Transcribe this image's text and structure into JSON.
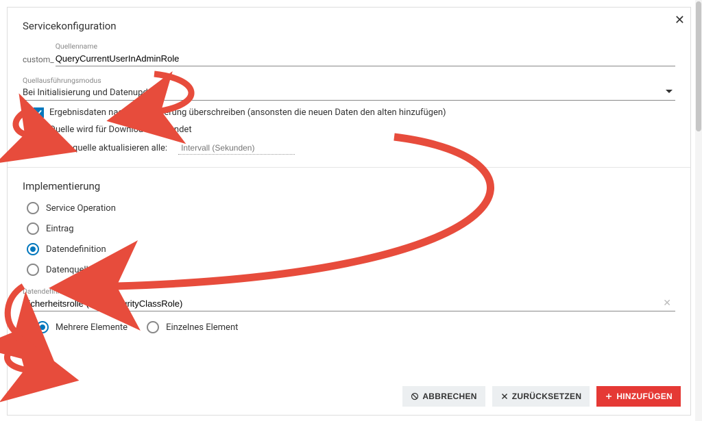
{
  "serviceConfig": {
    "title": "Servicekonfiguration",
    "sourceName": {
      "label": "Quellenname",
      "prefix": "custom_",
      "value": "QueryCurrentUserInAdminRole"
    },
    "execMode": {
      "label": "Quellausführungsmodus",
      "value": "Bei Initialisierung und Datenupdate"
    },
    "overwrite": {
      "checked": true,
      "label": "Ergebnisdaten nach Aktualisierung überschreiben (ansonsten die neuen Daten den alten hinzufügen)"
    },
    "download": {
      "checked": false,
      "label": "Quelle wird für Download verwendet"
    },
    "refresh": {
      "checked": false,
      "label": "Datenquelle aktualisieren alle:",
      "intervalPlaceholder": "Intervall (Sekunden)"
    }
  },
  "implementation": {
    "title": "Implementierung",
    "options": [
      {
        "label": "Service Operation",
        "selected": false
      },
      {
        "label": "Eintrag",
        "selected": false
      },
      {
        "label": "Datendefinition",
        "selected": true
      },
      {
        "label": "Datenquelle",
        "selected": false
      }
    ],
    "dataDef": {
      "label": "Datendefinition",
      "value": "Sicherheitsrolle (SPSSecurityClassRole)"
    },
    "itemMode": {
      "multi": {
        "label": "Mehrere Elemente",
        "selected": true
      },
      "single": {
        "label": "Einzelnes Element",
        "selected": false
      }
    }
  },
  "footer": {
    "cancel": "ABBRECHEN",
    "reset": "ZURÜCKSETZEN",
    "add": "HINZUFÜGEN"
  }
}
